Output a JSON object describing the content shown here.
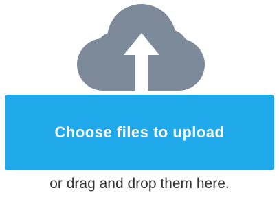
{
  "uploader": {
    "icon": "cloud-upload-icon",
    "button_label": "Choose files to upload",
    "hint_text": "or drag and drop them here."
  },
  "colors": {
    "cloud": "#7c8a99",
    "arrow": "#ffffff",
    "button_bg": "#1fa8ea",
    "button_text": "#ffffff",
    "hint_text": "#333333"
  }
}
